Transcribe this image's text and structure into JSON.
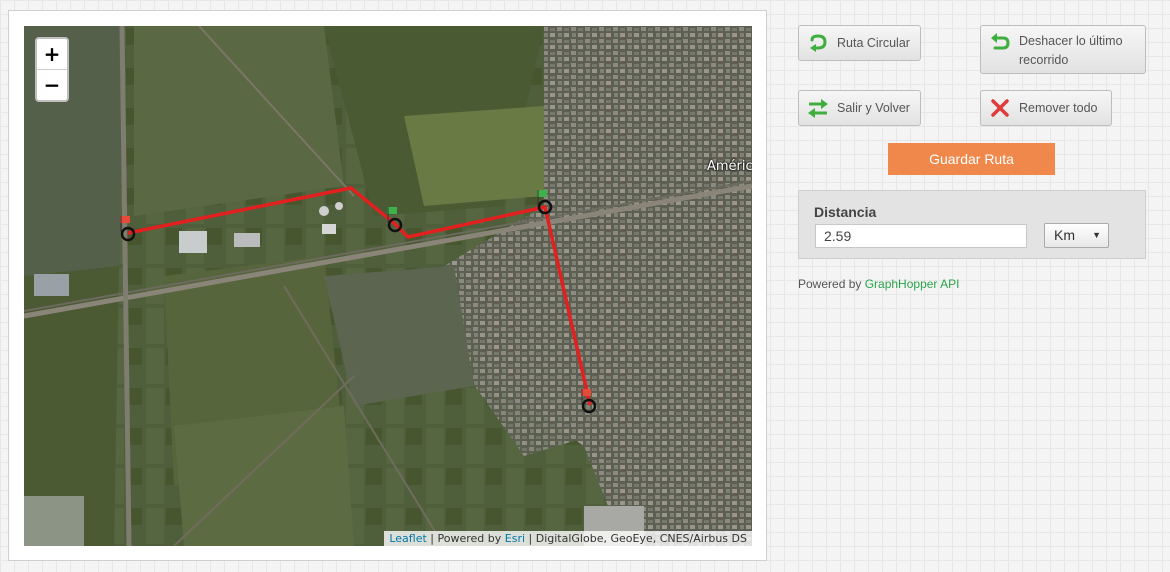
{
  "map": {
    "zoom_in": "+",
    "zoom_out": "−",
    "place_label": "América",
    "attribution": {
      "leaflet": "Leaflet",
      "sep1": " | Powered by ",
      "esri": "Esri",
      "rest": " | DigitalGlobe, GeoEye, CNES/Airbus DS"
    },
    "route_color": "#e32020"
  },
  "buttons": {
    "ruta_circular": "Ruta Circular",
    "deshacer_1": "Deshacer lo último",
    "deshacer_2": "recorrido",
    "salir_volver": "Salir y Volver",
    "remover": "Remover todo",
    "guardar": "Guardar Ruta"
  },
  "distance": {
    "title": "Distancia",
    "value": "2.59",
    "unit": "Km"
  },
  "footer": {
    "powered_prefix": "Powered by ",
    "api_link": "GraphHopper API"
  },
  "colors": {
    "accent": "#f0884b",
    "link": "#2aa34b",
    "route": "#e32020"
  }
}
